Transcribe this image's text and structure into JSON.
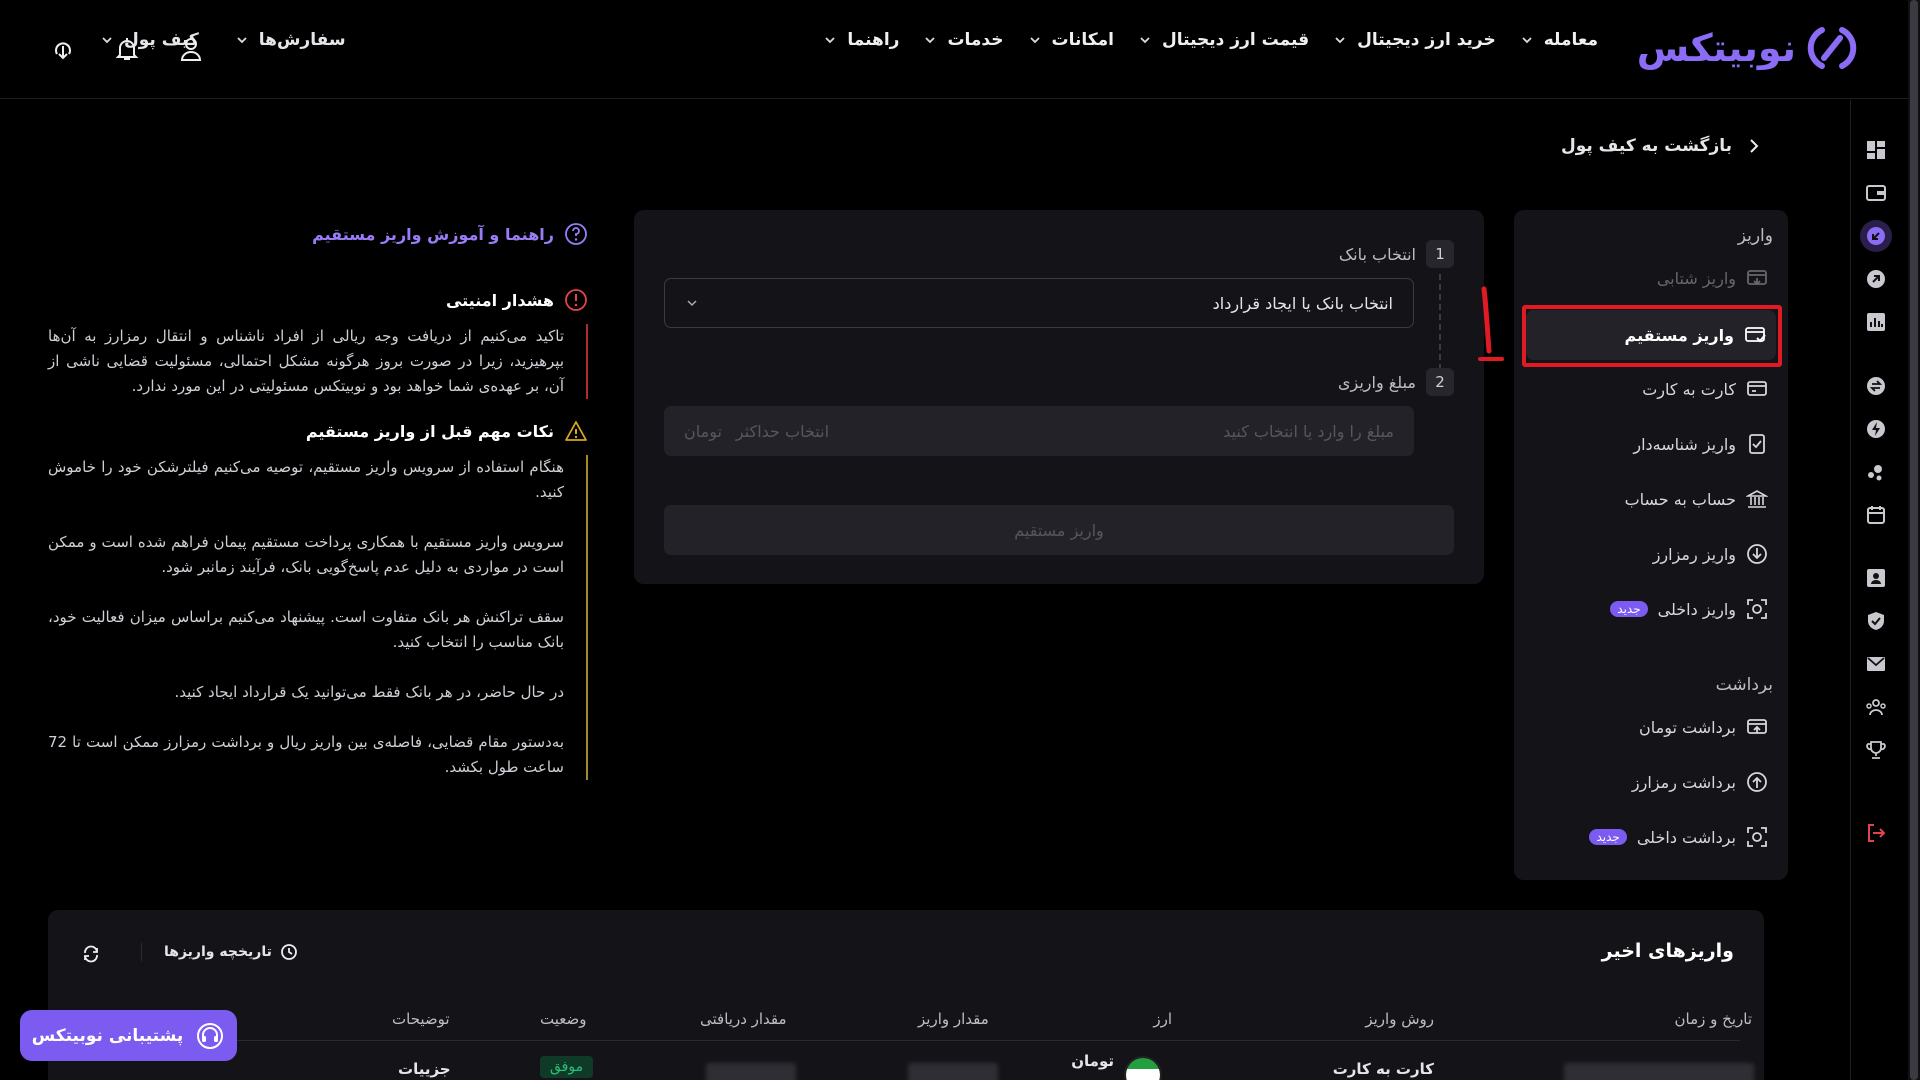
{
  "brand": {
    "name": "نوبیتکس",
    "accent": "#8b6cf6"
  },
  "nav": {
    "items": [
      {
        "label": "معامله"
      },
      {
        "label": "خرید ارز دیجیتال"
      },
      {
        "label": "قیمت ارز دیجیتال"
      },
      {
        "label": "امکانات"
      },
      {
        "label": "خدمات"
      },
      {
        "label": "راهنما"
      }
    ],
    "orders": "سفارش‌ها",
    "wallet": "کیف پول"
  },
  "back_link": "بازگشت به کیف پول",
  "side_menu": {
    "deposit_heading": "واریز",
    "deposit_items": [
      {
        "label": "واریز شتابی",
        "icon": "card-arrow-icon"
      },
      {
        "label": "واریز مستقیم",
        "icon": "card-direct-icon"
      },
      {
        "label": "کارت به کارت",
        "icon": "card-transfer-icon"
      },
      {
        "label": "واریز شناسه‌دار",
        "icon": "id-check-icon"
      },
      {
        "label": "حساب به حساب",
        "icon": "bank-icon"
      },
      {
        "label": "واریز رمزارز",
        "icon": "download-circle-icon"
      },
      {
        "label": "واریز داخلی",
        "icon": "scan-icon",
        "badge": "جدید"
      }
    ],
    "withdraw_heading": "برداشت",
    "withdraw_items": [
      {
        "label": "برداشت تومان",
        "icon": "card-out-icon"
      },
      {
        "label": "برداشت رمزارز",
        "icon": "upload-circle-icon"
      },
      {
        "label": "برداشت داخلی",
        "icon": "scan-icon",
        "badge": "جدید"
      }
    ]
  },
  "form": {
    "step1_num": "1",
    "step1_label": "انتخاب بانک",
    "bank_select": "انتخاب بانک یا ایجاد قرارداد",
    "step2_num": "2",
    "step2_label": "مبلغ واریزی",
    "amount_placeholder": "مبلغ را وارد یا انتخاب کنید",
    "max_label": "انتخاب حداکثر",
    "unit": "تومان",
    "submit": "واریز مستقیم"
  },
  "info": {
    "guide_link": "راهنما و آموزش واریز مستقیم",
    "security_title": "هشدار امنیتی",
    "security_text": "تاکید می‌کنیم از دریافت وجه ریالی از افراد ناشناس و انتقال رمزارز به آن‌ها بپرهیزید، زیرا در صورت بروز هرگونه مشکل احتمالی، مسئولیت قضایی ناشی از آن، بر عهده‌ی شما خواهد بود و نوبیتکس مسئولیتی در این مورد ندارد.",
    "tips_title": "نکات مهم قبل از واریز مستقیم",
    "tips": [
      "هنگام استفاده از سرویس واریز مستقیم، توصیه می‌کنیم فیلترشکن خود را خاموش کنید.",
      "سرویس واریز مستقیم با همکاری پرداخت مستقیم پیمان فراهم شده است و ممکن است در مواردی به دلیل عدم پاسخ‌گویی بانک، فرآیند زمانبر شود.",
      "سقف تراکنش هر بانک متفاوت است. پیشنهاد می‌کنیم براساس میزان فعالیت خود، بانک مناسب را انتخاب کنید.",
      "در حال حاضر، در هر بانک فقط می‌توانید یک قرارداد ایجاد کنید.",
      "به‌دستور مقام قضایی، فاصله‌ی بین واریز ریال و برداشت رمزارز ممکن است تا 72 ساعت طول بکشد."
    ]
  },
  "recent": {
    "title": "واریزهای اخیر",
    "history_button": "تاریخچه واریزها",
    "columns": [
      "تاریخ و زمان",
      "روش واریز",
      "ارز",
      "مقدار واریز",
      "مقدار دریافتی",
      "وضعیت",
      "توضیحات"
    ],
    "row": {
      "method": "کارت به کارت",
      "currency": "تومان",
      "status": "موفق",
      "details": "جزییات"
    }
  },
  "support": "پشتیبانی نوبیتکس",
  "colors": {
    "background": "#000000",
    "card": "#141418",
    "highlight": "#e11b24",
    "success": "#2fbf7c"
  }
}
